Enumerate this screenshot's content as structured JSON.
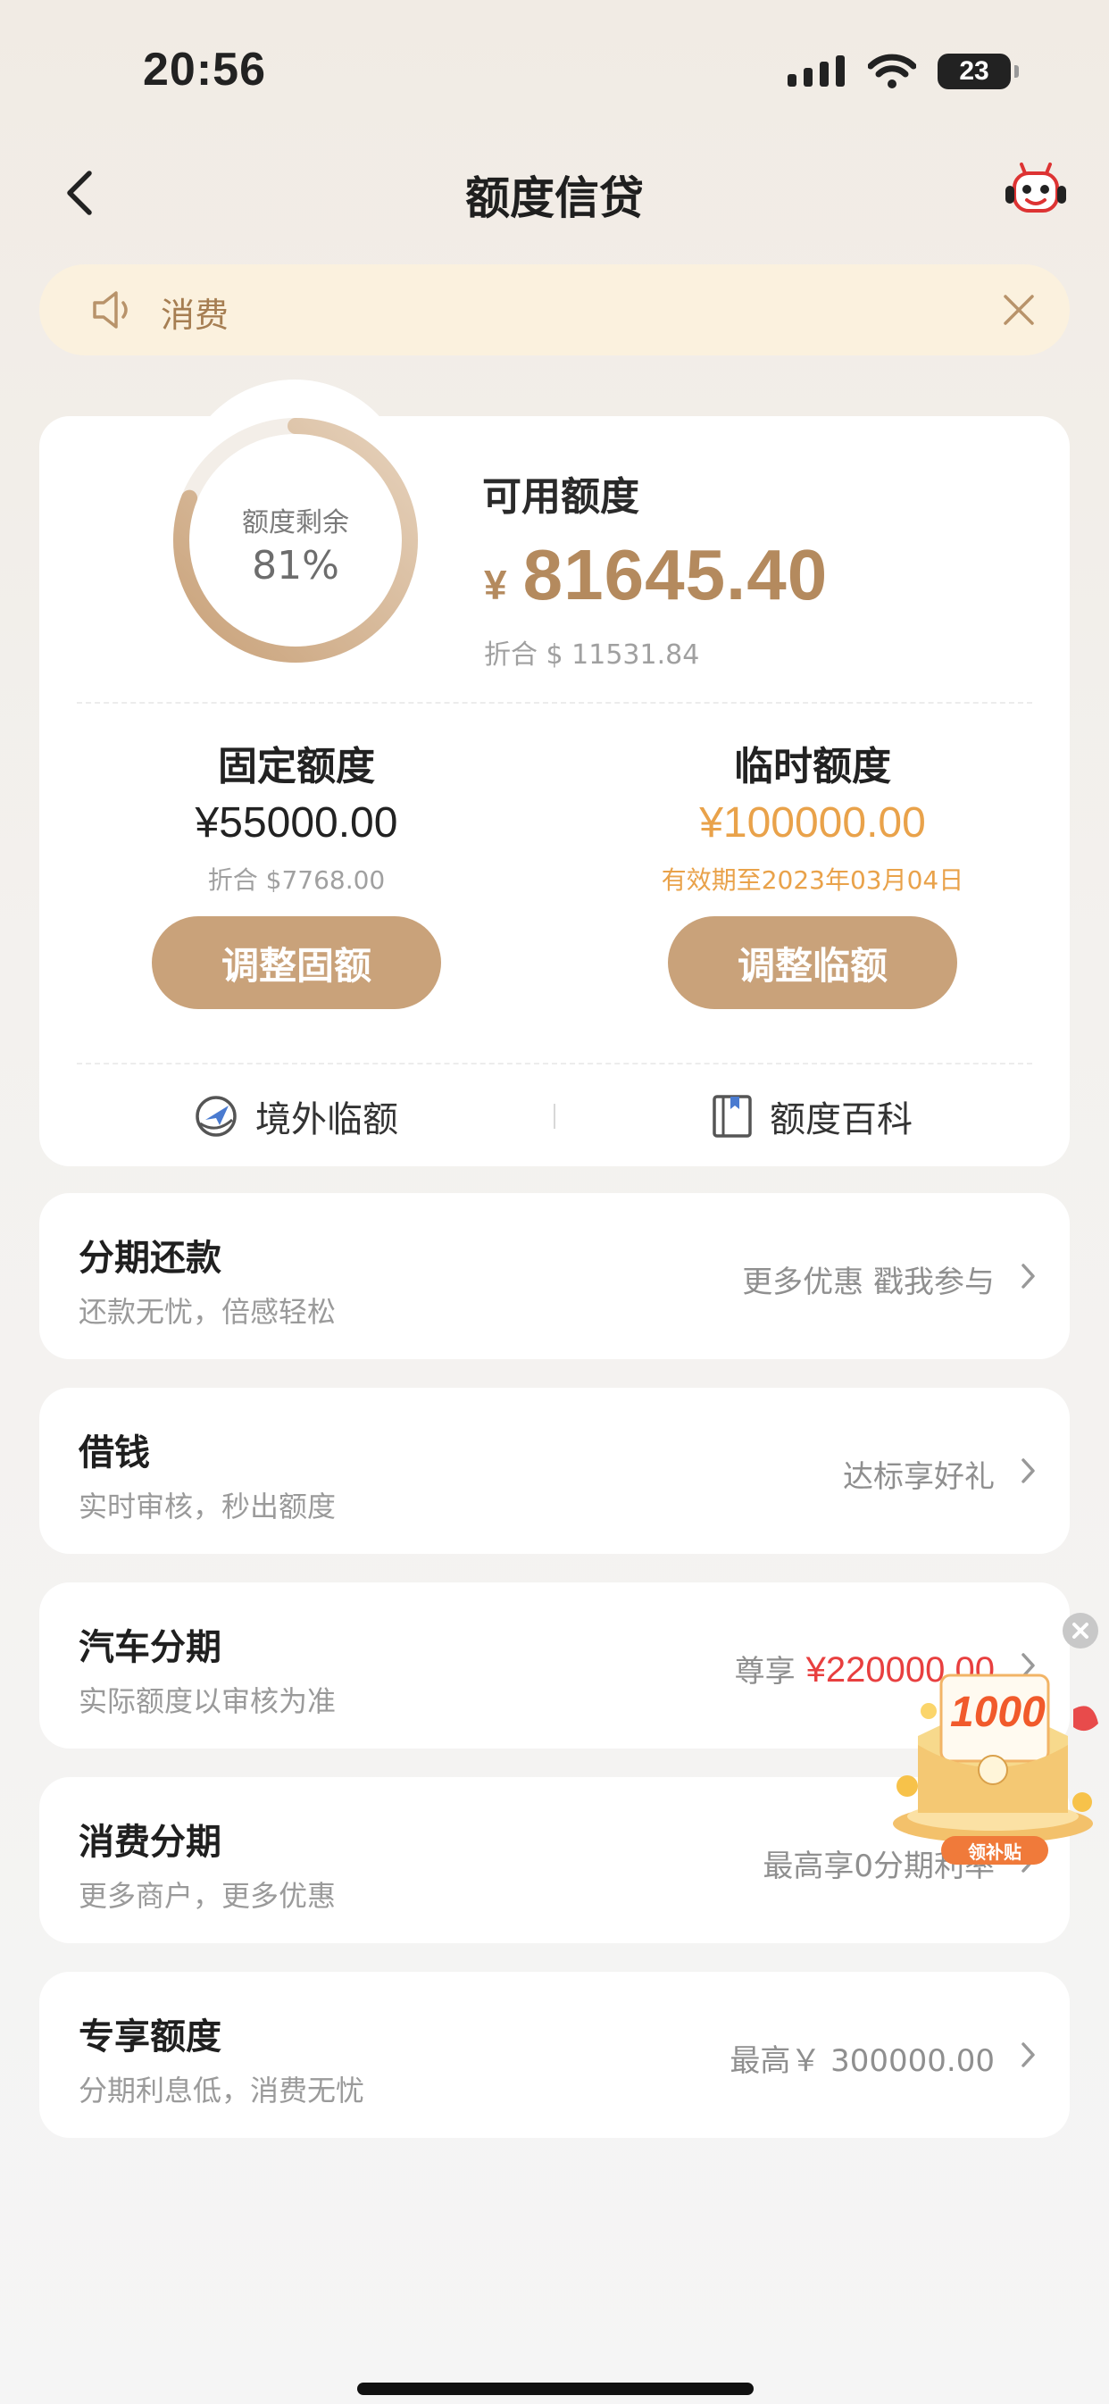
{
  "status_bar": {
    "time": "20:56",
    "battery": "23"
  },
  "nav": {
    "title": "额度信贷"
  },
  "notice": {
    "text": "消费"
  },
  "credit": {
    "ring_label": "额度剩余",
    "ring_percent_text": "81%",
    "ring_fraction": 0.81,
    "available_label": "可用额度",
    "available_currency": "¥",
    "available_amount": "81645.40",
    "available_conversion": "折合 $ 11531.84",
    "fixed": {
      "title": "固定额度",
      "amount": "¥55000.00",
      "sub": "折合 $7768.00",
      "button": "调整固额"
    },
    "temporary": {
      "title": "临时额度",
      "amount": "¥100000.00",
      "sub": "有效期至2023年03月04日",
      "button": "调整临额"
    },
    "links": {
      "overseas": "境外临额",
      "wiki": "额度百科"
    }
  },
  "services": [
    {
      "title": "分期还款",
      "subtitle": "还款无忧，倍感轻松",
      "right": "更多优惠 戳我参与"
    },
    {
      "title": "借钱",
      "subtitle": "实时审核，秒出额度",
      "right": "达标享好礼"
    },
    {
      "title": "汽车分期",
      "subtitle": "实际额度以审核为准",
      "right": "尊享",
      "right_highlight": "¥220000.00"
    },
    {
      "title": "消费分期",
      "subtitle": "更多商户，更多优惠",
      "right": "最高享0分期利率"
    },
    {
      "title": "专享额度",
      "subtitle": "分期利息低，消费无忧",
      "right": "最高￥ 300000.00"
    }
  ],
  "promo": {
    "amount": "1000",
    "label": "领补贴"
  },
  "colors": {
    "accent": "#c9a27a",
    "amount_gold": "#b48a5e",
    "temp_orange": "#e9a24a",
    "highlight_red": "#e83f3f",
    "notice_bg": "#fbf1de"
  }
}
